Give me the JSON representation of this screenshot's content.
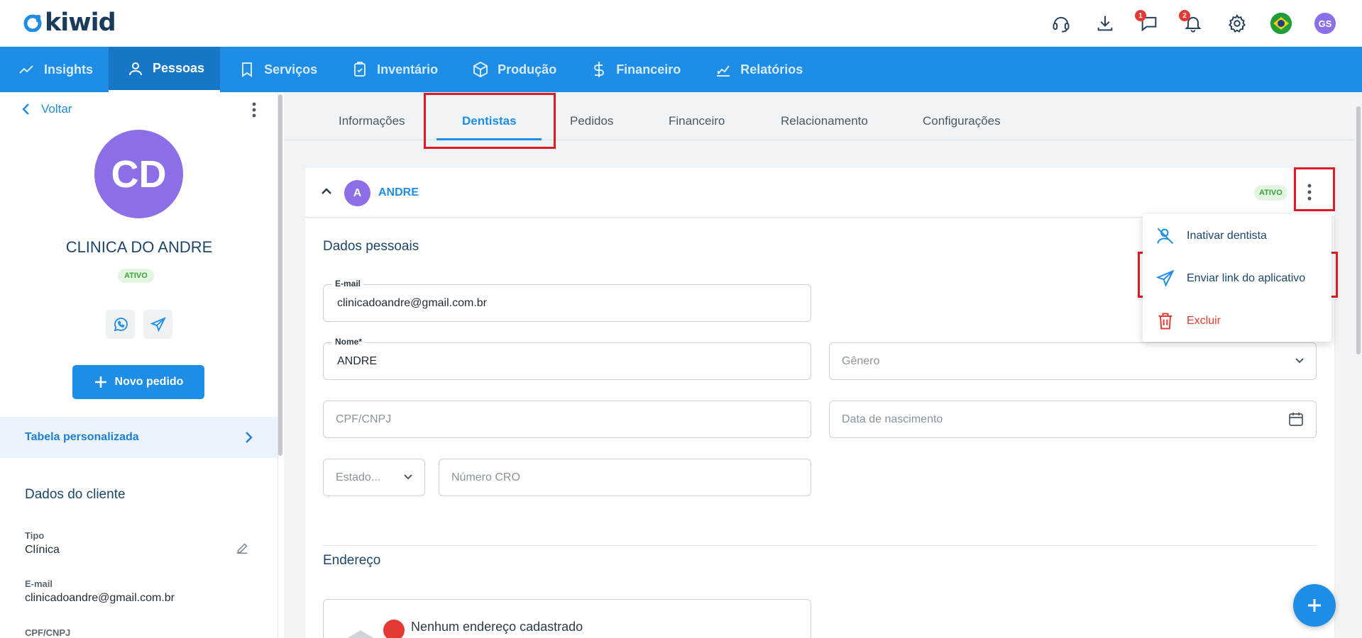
{
  "brand": {
    "logo_text": "kiwid"
  },
  "header": {
    "icons": [
      "headset-icon",
      "download-icon",
      "chat-icon",
      "bell-icon",
      "gear-icon",
      "brazil-flag-icon"
    ],
    "chat_badge": "1",
    "notification_badge": "2",
    "user_initials": "GS"
  },
  "nav": {
    "items": [
      {
        "label": "Insights",
        "icon": "insights-icon"
      },
      {
        "label": "Pessoas",
        "icon": "person-icon",
        "active": true
      },
      {
        "label": "Serviços",
        "icon": "tooth-icon"
      },
      {
        "label": "Inventário",
        "icon": "clipboard-icon"
      },
      {
        "label": "Produção",
        "icon": "box-icon"
      },
      {
        "label": "Financeiro",
        "icon": "dollar-icon"
      },
      {
        "label": "Relatórios",
        "icon": "report-icon"
      }
    ]
  },
  "sidebar": {
    "back_label": "Voltar",
    "avatar_initials": "CD",
    "client_name": "CLINICA DO ANDRE",
    "status": "ATIVO",
    "new_order_label": "Novo pedido",
    "custom_table_label": "Tabela personalizada",
    "client_data_title": "Dados do cliente",
    "fields": [
      {
        "label": "Tipo",
        "value": "Clínica"
      },
      {
        "label": "E-mail",
        "value": "clinicadoandre@gmail.com.br"
      },
      {
        "label": "CPF/CNPJ",
        "value": ""
      }
    ]
  },
  "tabs": {
    "items": [
      {
        "label": "Informações"
      },
      {
        "label": "Dentistas",
        "active": true
      },
      {
        "label": "Pedidos"
      },
      {
        "label": "Financeiro"
      },
      {
        "label": "Relacionamento"
      },
      {
        "label": "Configurações"
      }
    ]
  },
  "dentist_card": {
    "avatar_initial": "A",
    "name": "ANDRE",
    "status": "ATIVO",
    "personal_title": "Dados pessoais",
    "email_label": "E-mail",
    "email_value": "clinicadoandre@gmail.com.br",
    "name_label": "Nome*",
    "name_value": "ANDRE",
    "gender_placeholder": "Gênero",
    "cpf_placeholder": "CPF/CNPJ",
    "birth_placeholder": "Data de nascimento",
    "state_placeholder": "Estado...",
    "cro_placeholder": "Número CRO",
    "address_title": "Endereço",
    "no_address_text": "Nenhum endereço cadastrado"
  },
  "menu": {
    "items": [
      {
        "label": "Inativar dentista",
        "icon": "person-off-icon"
      },
      {
        "label": "Enviar link do aplicativo",
        "icon": "send-icon"
      },
      {
        "label": "Excluir",
        "icon": "trash-icon",
        "danger": true
      }
    ]
  },
  "colors": {
    "primary": "#1e8de6",
    "nav_active": "#1676c7",
    "danger": "#e53935",
    "highlight": "#e01b24",
    "avatar": "#8c6fe6"
  }
}
